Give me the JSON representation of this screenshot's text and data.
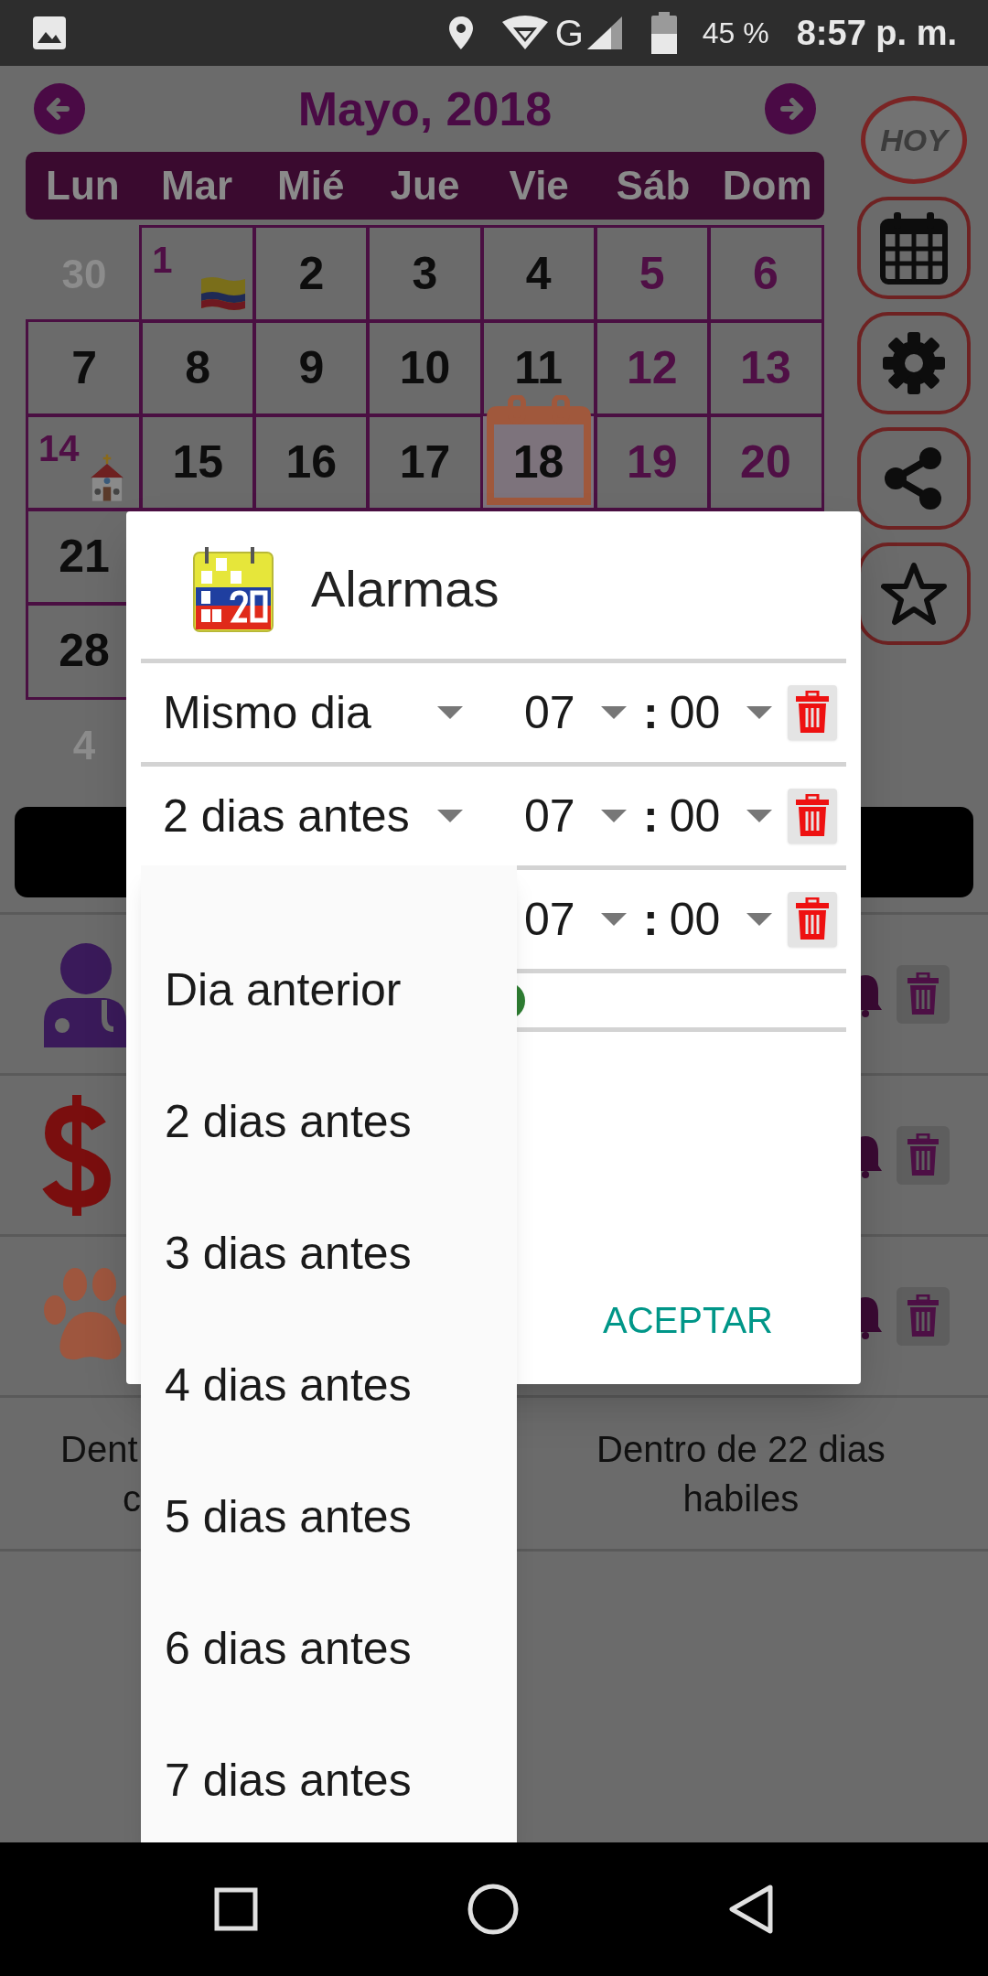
{
  "status_bar": {
    "network": "G",
    "battery": "45 %",
    "time": "8:57 p. m."
  },
  "calendar": {
    "title": "Mayo, 2018",
    "weekdays": [
      "Lun",
      "Mar",
      "Mié",
      "Jue",
      "Vie",
      "Sáb",
      "Dom"
    ],
    "weeks": [
      [
        {
          "day": "30",
          "kind": "other"
        },
        {
          "day": "1",
          "kind": "national_holiday"
        },
        {
          "day": "2",
          "kind": "weekday"
        },
        {
          "day": "3",
          "kind": "weekday"
        },
        {
          "day": "4",
          "kind": "weekday"
        },
        {
          "day": "5",
          "kind": "weekend"
        },
        {
          "day": "6",
          "kind": "weekend"
        }
      ],
      [
        {
          "day": "7",
          "kind": "weekday"
        },
        {
          "day": "8",
          "kind": "weekday"
        },
        {
          "day": "9",
          "kind": "weekday"
        },
        {
          "day": "10",
          "kind": "weekday"
        },
        {
          "day": "11",
          "kind": "weekday"
        },
        {
          "day": "12",
          "kind": "weekend"
        },
        {
          "day": "13",
          "kind": "weekend"
        }
      ],
      [
        {
          "day": "14",
          "kind": "religious_holiday"
        },
        {
          "day": "15",
          "kind": "weekday"
        },
        {
          "day": "16",
          "kind": "weekday"
        },
        {
          "day": "17",
          "kind": "weekday"
        },
        {
          "day": "18",
          "kind": "weekday",
          "today": true
        },
        {
          "day": "19",
          "kind": "weekend"
        },
        {
          "day": "20",
          "kind": "weekend"
        }
      ],
      [
        {
          "day": "21",
          "kind": "weekday"
        }
      ],
      [
        {
          "day": "28",
          "kind": "weekday"
        }
      ],
      [
        {
          "day": "4",
          "kind": "other"
        }
      ]
    ]
  },
  "side_buttons": [
    {
      "kind": "today",
      "label": "HOY"
    },
    {
      "kind": "calendar"
    },
    {
      "kind": "settings"
    },
    {
      "kind": "share"
    },
    {
      "kind": "favorite"
    }
  ],
  "events": [
    {
      "kind": "doctor"
    },
    {
      "kind": "money"
    },
    {
      "kind": "pet"
    }
  ],
  "footer": {
    "left_lines": [
      "Dent",
      "c"
    ],
    "right": "Dentro de 22 dias habiles"
  },
  "dialog": {
    "title": "Alarmas",
    "alarms": [
      {
        "when": "Mismo dia",
        "hour": "07",
        "separator": ":",
        "minute": "00"
      },
      {
        "when": "2 dias antes",
        "hour": "07",
        "separator": ":",
        "minute": "00"
      },
      {
        "hour": "07",
        "separator": ":",
        "minute": "00"
      }
    ],
    "ok_button": "ACEPTAR"
  },
  "dropdown": {
    "options": [
      "Dia anterior",
      "2 dias antes",
      "3 dias antes",
      "4 dias antes",
      "5 dias antes",
      "6 dias antes",
      "7 dias antes"
    ]
  }
}
